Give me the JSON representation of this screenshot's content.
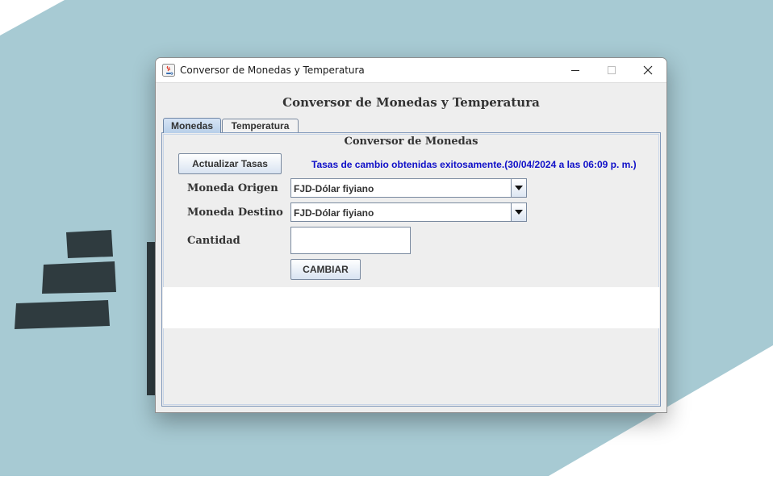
{
  "window": {
    "title": "Conversor de Monedas y Temperatura"
  },
  "main": {
    "heading": "Conversor de Monedas y Temperatura"
  },
  "tabs": [
    {
      "label": "Monedas",
      "active": true
    },
    {
      "label": "Temperatura",
      "active": false
    }
  ],
  "currency": {
    "heading": "Conversor de Monedas",
    "update_button": "Actualizar Tasas",
    "status": "Tasas de cambio obtenidas exitosamente.(30/04/2024 a las 06:09 p. m.)",
    "origin_label": "Moneda Origen",
    "origin_value": "FJD-Dólar fiyiano",
    "destination_label": "Moneda Destino",
    "destination_value": "FJD-Dólar fiyiano",
    "amount_label": "Cantidad",
    "amount_value": "",
    "change_button": "CAMBIAR"
  },
  "colors": {
    "status_text": "#1010c8",
    "wallpaper": "#a7cad3"
  }
}
